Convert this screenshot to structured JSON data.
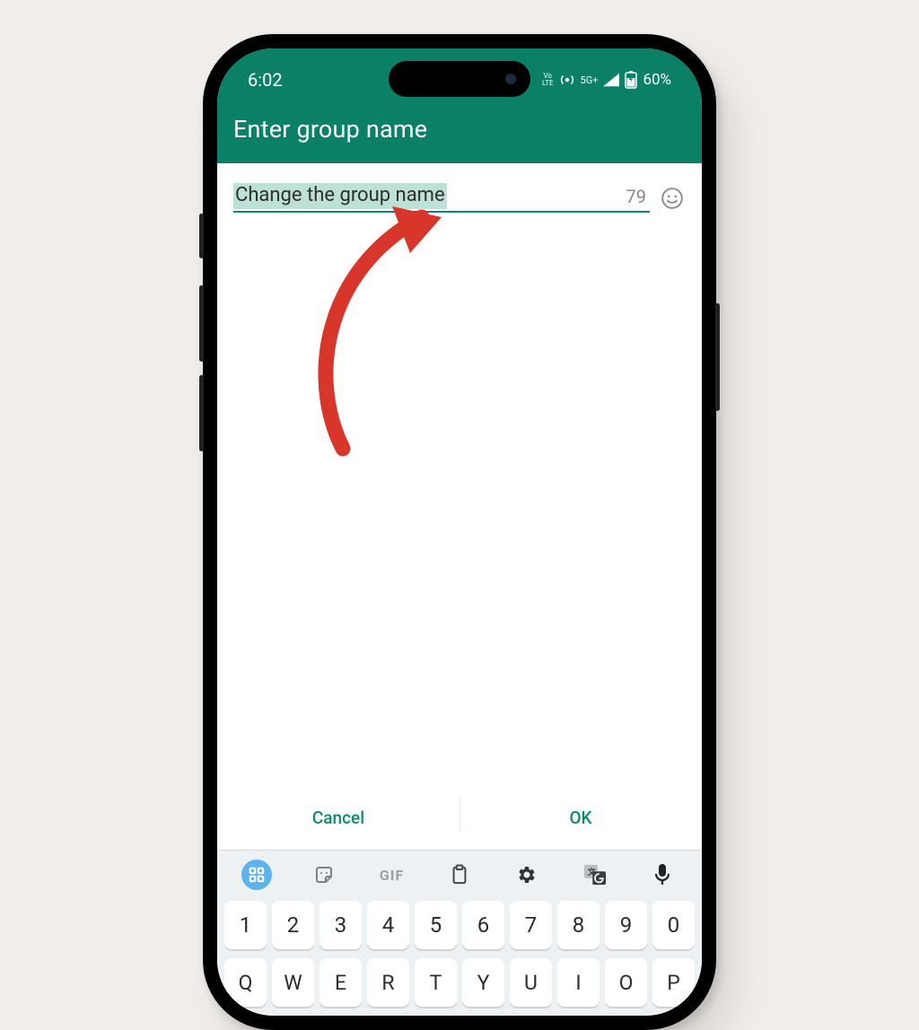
{
  "status": {
    "time": "6:02",
    "volte": "Vo\nLTE",
    "network": "5G+",
    "battery": "60%"
  },
  "header": {
    "title": "Enter group name"
  },
  "input": {
    "value": "Change the group name",
    "charsRemaining": "79"
  },
  "dialog": {
    "cancel": "Cancel",
    "ok": "OK"
  },
  "keyboard": {
    "gif": "GIF",
    "numbers": [
      "1",
      "2",
      "3",
      "4",
      "5",
      "6",
      "7",
      "8",
      "9",
      "0"
    ],
    "letters": [
      "Q",
      "W",
      "E",
      "R",
      "T",
      "Y",
      "U",
      "I",
      "O",
      "P"
    ]
  }
}
